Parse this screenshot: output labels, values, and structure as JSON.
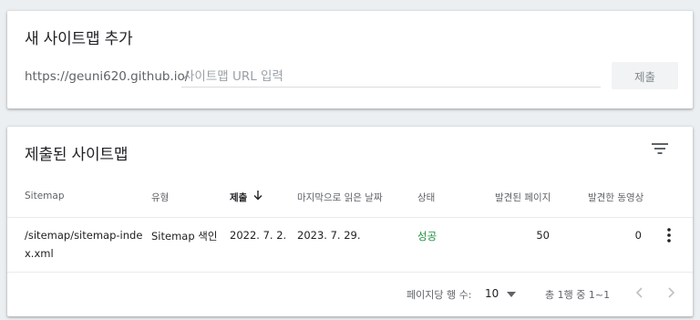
{
  "add_card": {
    "title": "새 사이트맵 추가",
    "url_prefix": "https://geuni620.github.io/",
    "url_placeholder": "사이트맵 URL 입력",
    "submit_label": "제출"
  },
  "submitted_card": {
    "title": "제출된 사이트맵",
    "columns": [
      "Sitemap",
      "유형",
      "제출",
      "마지막으로 읽은 날짜",
      "상태",
      "발견된 페이지",
      "발견한 동영상"
    ],
    "rows": [
      {
        "sitemap_line1": "/sitemap/sitemap-inde",
        "sitemap_line2": "x.xml",
        "type": "Sitemap 색인",
        "submitted": "2022. 7. 2.",
        "last_read": "2023. 7. 29.",
        "status": "성공",
        "pages": "50",
        "videos": "0"
      }
    ],
    "footer": {
      "rows_per_page_label": "페이지당 행 수:",
      "rows_per_page": "10",
      "range": "총 1행 중 1~1"
    }
  },
  "colors": {
    "success": "#1e8e3e",
    "background": "#eceff1"
  }
}
